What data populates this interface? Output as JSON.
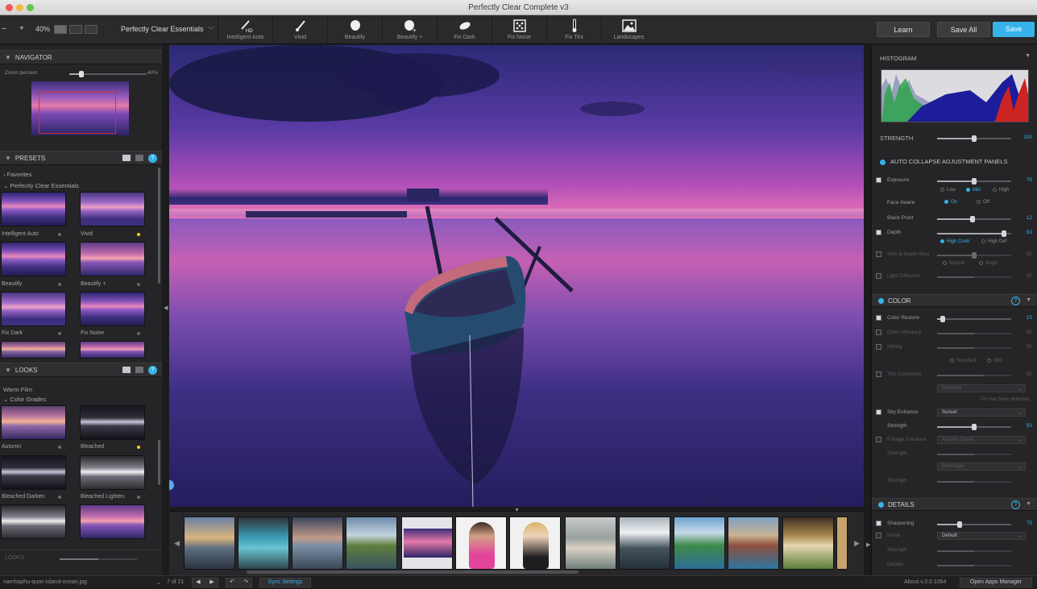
{
  "window": {
    "title": "Perfectly Clear Complete v3"
  },
  "toolbar": {
    "minus": "–",
    "plus": "+",
    "zoom": "40%",
    "preset_select": "Perfectly Clear Essentials",
    "tools": [
      {
        "label": "Intelligent Auto",
        "icon": "wand-hd-icon"
      },
      {
        "label": "Vivid",
        "icon": "brush-icon"
      },
      {
        "label": "Beautify",
        "icon": "face-icon"
      },
      {
        "label": "Beautify +",
        "icon": "face-plus-icon"
      },
      {
        "label": "Fix Dark",
        "icon": "bulb-icon"
      },
      {
        "label": "Fix Noise",
        "icon": "dice-icon"
      },
      {
        "label": "Fix Tint",
        "icon": "thermometer-icon"
      },
      {
        "label": "Landscapes",
        "icon": "landscape-icon"
      }
    ],
    "learn": "Learn",
    "save_all": "Save All",
    "save": "Save"
  },
  "navigator": {
    "title": "NAVIGATOR",
    "zoom_label": "Zoom percent",
    "zoom_value": "40%"
  },
  "presets": {
    "title": "PRESETS",
    "tree": [
      "Favorites",
      "Perfectly Clear Essentials"
    ],
    "items": [
      "Intelligent Auto",
      "Vivid",
      "Beautify",
      "Beautify +",
      "Fix Dark",
      "Fix Noise"
    ]
  },
  "looks": {
    "title": "LOOKS",
    "tree": [
      "Warm Film",
      "Color Grades"
    ],
    "items": [
      "Autumn",
      "Bleached",
      "Bleached Darken",
      "Bleached Lighten"
    ],
    "footer_label": "LOOKS"
  },
  "right": {
    "histogram_title": "HISTOGRAM",
    "strength_label": "STRENGTH",
    "strength_value": "100",
    "strength_fraction": 0.5,
    "auto_collapse": "AUTO COLLAPSE ADJUSTMENT PANELS",
    "exposure": {
      "label": "Exposure",
      "value": "75",
      "fraction": 0.5,
      "radio": [
        "Low",
        "Mid",
        "High"
      ],
      "face_aware": "Face Aware",
      "face_opts": [
        "On",
        "Off"
      ],
      "black_point": "Black Point",
      "black_point_value": "12",
      "black_point_fraction": 0.48,
      "depth": "Depth",
      "depth_value": "93",
      "depth_fraction": 0.9,
      "depth_opts": [
        "High Contr",
        "High Def"
      ],
      "skin_depth": "Skin & Depth Bias",
      "skin_depth_value": "50",
      "skin_opts": [
        "Natural",
        "Bright"
      ],
      "light_diffusion": "Light Diffusion",
      "light_diffusion_value": "50"
    },
    "color": {
      "title": "COLOR",
      "color_restore": "Color Restore",
      "color_restore_value": "15",
      "color_restore_fraction": 0.08,
      "vibrancy": "Color Vibrancy",
      "vibrancy_value": "50",
      "infinity": "Infinity",
      "infinity_value": "50",
      "infinity_opts": [
        "Standard",
        "Mild"
      ],
      "tint_correction": "Tint Correction",
      "tint_correction_value": "50",
      "tint_dropdown": "Standard",
      "tint_note": "Tint has been detected",
      "sky_enhance": "Sky Enhance",
      "sky_dropdown": "Sunset",
      "sky_strength": "Strength",
      "sky_strength_value": "50",
      "sky_strength_fraction": 0.5,
      "foliage": "Foliage Enhance",
      "foliage_dropdown": "Autumn Colors",
      "foliage_strength": "Strength",
      "foliage_dropdown2": "Pink/Sage",
      "foliage_strength2": "Strength"
    },
    "details": {
      "title": "DETAILS",
      "sharpening": "Sharpening",
      "sharpening_value": "75",
      "sharpening_fraction": 0.3,
      "noise": "Noise",
      "noise_dropdown": "Default",
      "strength": "Strength",
      "detail": "Details"
    }
  },
  "status": {
    "filename": "namhaphu-quoc-island-ocean.jpg",
    "count": "7 of 21",
    "sync": "Sync Settings",
    "about": "About v.3.0.1064",
    "apps": "Open Apps Manager"
  }
}
